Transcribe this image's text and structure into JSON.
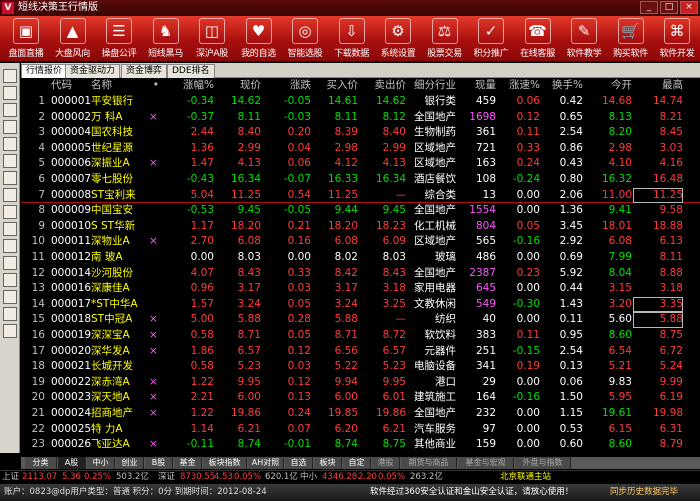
{
  "window": {
    "title": "短线决策王行情版",
    "logo": "V"
  },
  "toolbar": [
    {
      "label": "盘面直播",
      "icon": "monitor-icon"
    },
    {
      "label": "大盘风向",
      "icon": "index-flag-icon"
    },
    {
      "label": "操盘公评",
      "icon": "database-icon"
    },
    {
      "label": "短线黑马",
      "icon": "horse-icon"
    },
    {
      "label": "深沪A股",
      "icon": "stock-a-icon"
    },
    {
      "label": "我的自选",
      "icon": "favorites-icon"
    },
    {
      "label": "智能选股",
      "icon": "smart-select-icon"
    },
    {
      "label": "下载数据",
      "icon": "download-icon"
    },
    {
      "label": "系统设置",
      "icon": "settings-icon"
    },
    {
      "label": "股票交易",
      "icon": "gavel-icon"
    },
    {
      "label": "积分推广",
      "icon": "checklist-icon"
    },
    {
      "label": "在线客服",
      "icon": "customer-service-icon"
    },
    {
      "label": "软件教学",
      "icon": "tutorial-icon"
    },
    {
      "label": "购买软件",
      "icon": "cart-icon"
    },
    {
      "label": "软件开发",
      "icon": "dev-icon"
    }
  ],
  "tabs": [
    "行情报价",
    "资金驱动力",
    "资金博弈",
    "DDE排名"
  ],
  "headers": [
    "代码",
    "名称",
    "•",
    "涨幅%",
    "现价",
    "涨跌",
    "买入价",
    "卖出价",
    "细分行业",
    "现量",
    "涨速%",
    "换手%",
    "今开",
    "最高",
    "最低"
  ],
  "rows": [
    {
      "i": "1",
      "code": "000001",
      "name": "平安银行",
      "m": "",
      "pct": "-0.34",
      "price": "14.62",
      "chg": "-0.05",
      "bid": "14.61",
      "ask": "14.62",
      "ind": "银行类",
      "vol": "459",
      "spd": "0.06",
      "turn": "0.42",
      "open": "14.68",
      "high": "14.74",
      "low": "14.54"
    },
    {
      "i": "2",
      "code": "000002",
      "name": "万  科A",
      "m": "×",
      "pct": "-0.37",
      "price": "8.11",
      "chg": "-0.03",
      "bid": "8.11",
      "ask": "8.12",
      "ind": "全国地产",
      "vol": "1698",
      "spd": "0.12",
      "turn": "0.65",
      "open": "8.13",
      "high": "8.21",
      "low": "7.98"
    },
    {
      "i": "3",
      "code": "000004",
      "name": "国农科技",
      "m": "",
      "pct": "2.44",
      "price": "8.40",
      "chg": "0.20",
      "bid": "8.39",
      "ask": "8.40",
      "ind": "生物制药",
      "vol": "361",
      "spd": "0.11",
      "turn": "2.54",
      "open": "8.20",
      "high": "8.45",
      "low": "8.20"
    },
    {
      "i": "4",
      "code": "000005",
      "name": "世纪星源",
      "m": "",
      "pct": "1.36",
      "price": "2.99",
      "chg": "0.04",
      "bid": "2.98",
      "ask": "2.99",
      "ind": "区域地产",
      "vol": "721",
      "spd": "0.33",
      "turn": "0.86",
      "open": "2.98",
      "high": "3.03",
      "low": "2.94"
    },
    {
      "i": "5",
      "code": "000006",
      "name": "深振业A",
      "m": "×",
      "pct": "1.47",
      "price": "4.13",
      "chg": "0.06",
      "bid": "4.12",
      "ask": "4.13",
      "ind": "区域地产",
      "vol": "163",
      "spd": "0.24",
      "turn": "0.43",
      "open": "4.10",
      "high": "4.16",
      "low": "4.08"
    },
    {
      "i": "6",
      "code": "000007",
      "name": "零七股份",
      "m": "",
      "pct": "-0.43",
      "price": "16.34",
      "chg": "-0.07",
      "bid": "16.33",
      "ask": "16.34",
      "ind": "酒店餐饮",
      "vol": "108",
      "spd": "-0.24",
      "turn": "0.80",
      "open": "16.32",
      "high": "16.48",
      "low": "16.22"
    },
    {
      "i": "7",
      "code": "000008",
      "name": "ST宝利来",
      "m": "",
      "pct": "5.04",
      "price": "11.25",
      "chg": "0.54",
      "bid": "11.25",
      "ask": "—",
      "ind": "综合类",
      "vol": "13",
      "spd": "0.00",
      "turn": "2.06",
      "open": "11.00",
      "high": "11.25",
      "low": "10.89"
    },
    {
      "i": "8",
      "code": "000009",
      "name": "中国宝安",
      "m": "",
      "pct": "-0.53",
      "price": "9.45",
      "chg": "-0.05",
      "bid": "9.44",
      "ask": "9.45",
      "ind": "全国地产",
      "vol": "1554",
      "spd": "0.00",
      "turn": "1.36",
      "open": "9.41",
      "high": "9.58",
      "low": "9.35"
    },
    {
      "i": "9",
      "code": "000010",
      "name": "S ST华新",
      "m": "",
      "pct": "1.17",
      "price": "18.20",
      "chg": "0.21",
      "bid": "18.20",
      "ask": "18.23",
      "ind": "化工机械",
      "vol": "804",
      "spd": "0.05",
      "turn": "3.45",
      "open": "18.01",
      "high": "18.88",
      "low": "18.00"
    },
    {
      "i": "10",
      "code": "000011",
      "name": "深物业A",
      "m": "×",
      "pct": "2.70",
      "price": "6.08",
      "chg": "0.16",
      "bid": "6.08",
      "ask": "6.09",
      "ind": "区域地产",
      "vol": "565",
      "spd": "-0.16",
      "turn": "2.92",
      "open": "6.08",
      "high": "6.13",
      "low": "5.90"
    },
    {
      "i": "11",
      "code": "000012",
      "name": "南  玻A",
      "m": "",
      "pct": "0.00",
      "price": "8.03",
      "chg": "0.00",
      "bid": "8.02",
      "ask": "8.03",
      "ind": "玻璃",
      "vol": "486",
      "spd": "0.00",
      "turn": "0.69",
      "open": "7.99",
      "high": "8.11",
      "low": "7.95"
    },
    {
      "i": "12",
      "code": "000014",
      "name": "沙河股份",
      "m": "",
      "pct": "4.07",
      "price": "8.43",
      "chg": "0.33",
      "bid": "8.42",
      "ask": "8.43",
      "ind": "全国地产",
      "vol": "2387",
      "spd": "0.23",
      "turn": "5.92",
      "open": "8.04",
      "high": "8.88",
      "low": "8.04"
    },
    {
      "i": "13",
      "code": "000016",
      "name": "深康佳A",
      "m": "",
      "pct": "0.96",
      "price": "3.17",
      "chg": "0.03",
      "bid": "3.17",
      "ask": "3.18",
      "ind": "家用电器",
      "vol": "645",
      "spd": "0.00",
      "turn": "0.44",
      "open": "3.15",
      "high": "3.18",
      "low": "3.14"
    },
    {
      "i": "14",
      "code": "000017",
      "name": "*ST中华A",
      "m": "",
      "pct": "1.57",
      "price": "3.24",
      "chg": "0.05",
      "bid": "3.24",
      "ask": "3.25",
      "ind": "文教休闲",
      "vol": "549",
      "spd": "-0.30",
      "turn": "1.43",
      "open": "3.20",
      "high": "3.35",
      "low": "3.19"
    },
    {
      "i": "15",
      "code": "000018",
      "name": "ST中冠A",
      "m": "×",
      "pct": "5.00",
      "price": "5.88",
      "chg": "0.28",
      "bid": "5.88",
      "ask": "—",
      "ind": "纺织",
      "vol": "40",
      "spd": "0.00",
      "turn": "0.11",
      "open": "5.60",
      "high": "5.88",
      "low": "5.60"
    },
    {
      "i": "16",
      "code": "000019",
      "name": "深深宝A",
      "m": "×",
      "pct": "0.58",
      "price": "8.71",
      "chg": "0.05",
      "bid": "8.71",
      "ask": "8.72",
      "ind": "软饮料",
      "vol": "383",
      "spd": "0.11",
      "turn": "0.95",
      "open": "8.60",
      "high": "8.75",
      "low": "8.57"
    },
    {
      "i": "17",
      "code": "000020",
      "name": "深华发A",
      "m": "×",
      "pct": "1.86",
      "price": "6.57",
      "chg": "0.12",
      "bid": "6.56",
      "ask": "6.57",
      "ind": "元器件",
      "vol": "251",
      "spd": "-0.15",
      "turn": "2.54",
      "open": "6.54",
      "high": "6.72",
      "low": "6.48"
    },
    {
      "i": "18",
      "code": "000021",
      "name": "长城开发",
      "m": "",
      "pct": "0.58",
      "price": "5.23",
      "chg": "0.03",
      "bid": "5.22",
      "ask": "5.23",
      "ind": "电脑设备",
      "vol": "341",
      "spd": "0.19",
      "turn": "0.13",
      "open": "5.21",
      "high": "5.24",
      "low": "5.17"
    },
    {
      "i": "19",
      "code": "000022",
      "name": "深赤湾A",
      "m": "×",
      "pct": "1.22",
      "price": "9.95",
      "chg": "0.12",
      "bid": "9.94",
      "ask": "9.95",
      "ind": "港口",
      "vol": "29",
      "spd": "0.00",
      "turn": "0.06",
      "open": "9.83",
      "high": "9.99",
      "low": "9.78"
    },
    {
      "i": "20",
      "code": "000023",
      "name": "深天地A",
      "m": "×",
      "pct": "2.21",
      "price": "6.00",
      "chg": "0.13",
      "bid": "6.00",
      "ask": "6.01",
      "ind": "建筑施工",
      "vol": "164",
      "spd": "-0.16",
      "turn": "1.50",
      "open": "5.95",
      "high": "6.19",
      "low": "5.95"
    },
    {
      "i": "21",
      "code": "000024",
      "name": "招商地产",
      "m": "×",
      "pct": "1.22",
      "price": "19.86",
      "chg": "0.24",
      "bid": "19.85",
      "ask": "19.86",
      "ind": "全国地产",
      "vol": "232",
      "spd": "0.00",
      "turn": "1.15",
      "open": "19.61",
      "high": "19.98",
      "low": "19.50"
    },
    {
      "i": "22",
      "code": "000025",
      "name": "特  力A",
      "m": "",
      "pct": "1.14",
      "price": "6.21",
      "chg": "0.07",
      "bid": "6.20",
      "ask": "6.21",
      "ind": "汽车服务",
      "vol": "97",
      "spd": "0.00",
      "turn": "0.53",
      "open": "6.15",
      "high": "6.31",
      "low": "6.14"
    },
    {
      "i": "23",
      "code": "000026",
      "name": "飞亚达A",
      "m": "×",
      "pct": "-0.11",
      "price": "8.74",
      "chg": "-0.01",
      "bid": "8.74",
      "ask": "8.75",
      "ind": "其他商业",
      "vol": "159",
      "spd": "0.00",
      "turn": "0.60",
      "open": "8.60",
      "high": "8.79",
      "low": "8.58"
    },
    {
      "i": "24",
      "code": "000027",
      "name": "深圳能源",
      "m": "",
      "pct": "—",
      "price": "—",
      "chg": "—",
      "bid": "—",
      "ask": "—",
      "ind": "火力发电",
      "vol": "0",
      "spd": "—",
      "turn": "—",
      "open": "—",
      "high": "—",
      "low": "—"
    }
  ],
  "category_tabs": [
    "分类",
    "A股",
    "中小",
    "创业",
    "B股",
    "基金",
    "板块指数",
    "AH对照",
    "自选",
    "板块",
    "自定",
    "港股",
    "期货与商品",
    "基金与宏观",
    "外盘与指数"
  ],
  "status": {
    "sh_label": "上证",
    "sh_val": "2113.07",
    "sh_chg": "5.36",
    "sh_pct": "0.25%",
    "sh_amt": "503.2亿",
    "sz_label": "深证",
    "sz_val": "8730.55",
    "sz_chg": "4.53",
    "sz_pct": "0.05%",
    "sz_amt": "620.1亿",
    "zx_label": "中小",
    "zx_val": "4346.28",
    "zx_chg": "2.20",
    "zx_pct": "0.05%",
    "zx_amt": "263.2亿",
    "server": "北京联通主站"
  },
  "account": {
    "info": "账户：0823@dp用户类型：普通  积分：0分 到期时间：2012-08-24",
    "notice": "软件经过360安全认证和金山安全认证，请放心使用！",
    "sync": "同步历史数据完毕"
  },
  "colors": {
    "up": "#ff3b3b",
    "down": "#00e000",
    "flat": "#ffffff",
    "name": "#ffff00",
    "accent_red": "#c8102e"
  }
}
